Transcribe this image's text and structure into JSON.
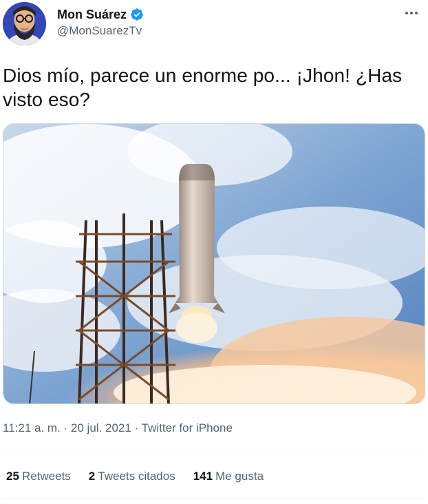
{
  "author": {
    "name": "Mon Suárez",
    "handle": "@MonSuarezTv",
    "verified": true
  },
  "tweet": {
    "text": "Dios mío, parece un enorme po... ¡Jhon! ¿Has visto eso?",
    "media_icon": "rocket-launch-photo"
  },
  "meta": {
    "time": "11:21 a. m.",
    "separator1": " · ",
    "date": "20 jul. 2021",
    "separator2": " · ",
    "source": "Twitter for iPhone"
  },
  "stats": [
    {
      "count": "25",
      "label": "Retweets"
    },
    {
      "count": "2",
      "label": "Tweets citados"
    },
    {
      "count": "141",
      "label": "Me gusta"
    }
  ],
  "colors": {
    "text": "#0f1419",
    "secondary": "#536471",
    "verified": "#1d9bf0",
    "divider": "#eff3f4"
  },
  "icons": [
    "verified-badge-icon",
    "more-options-icon"
  ]
}
